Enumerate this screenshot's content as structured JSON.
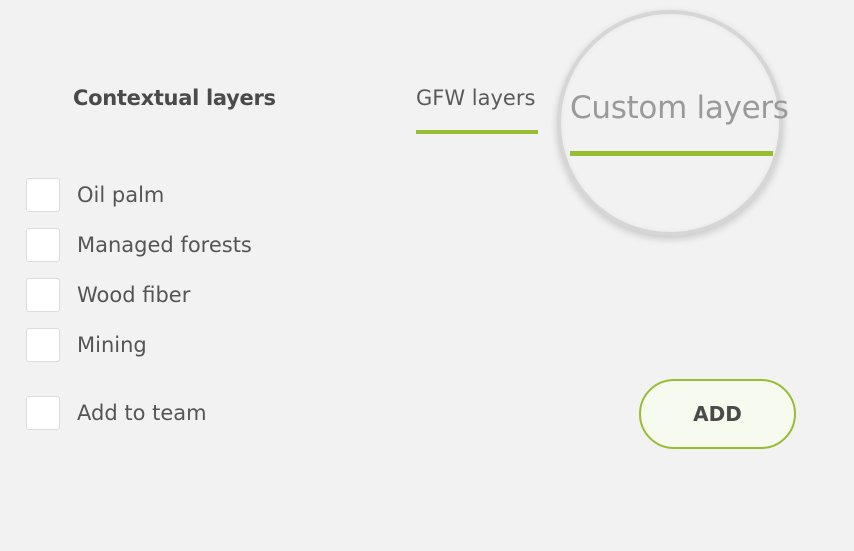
{
  "header": {
    "title": "Contextual layers"
  },
  "tabs": [
    {
      "label": "GFW layers",
      "active": true
    },
    {
      "label": "Custom layers",
      "active": false
    }
  ],
  "layers": [
    {
      "label": "Oil palm",
      "checked": false
    },
    {
      "label": "Managed forests",
      "checked": false
    },
    {
      "label": "Wood fiber",
      "checked": false
    },
    {
      "label": "Mining",
      "checked": false
    }
  ],
  "team_option": {
    "label": "Add to team",
    "checked": false
  },
  "add_button": {
    "label": "ADD"
  },
  "colors": {
    "accent": "#97be32",
    "background": "#f2f2f2",
    "text": "#555555"
  }
}
